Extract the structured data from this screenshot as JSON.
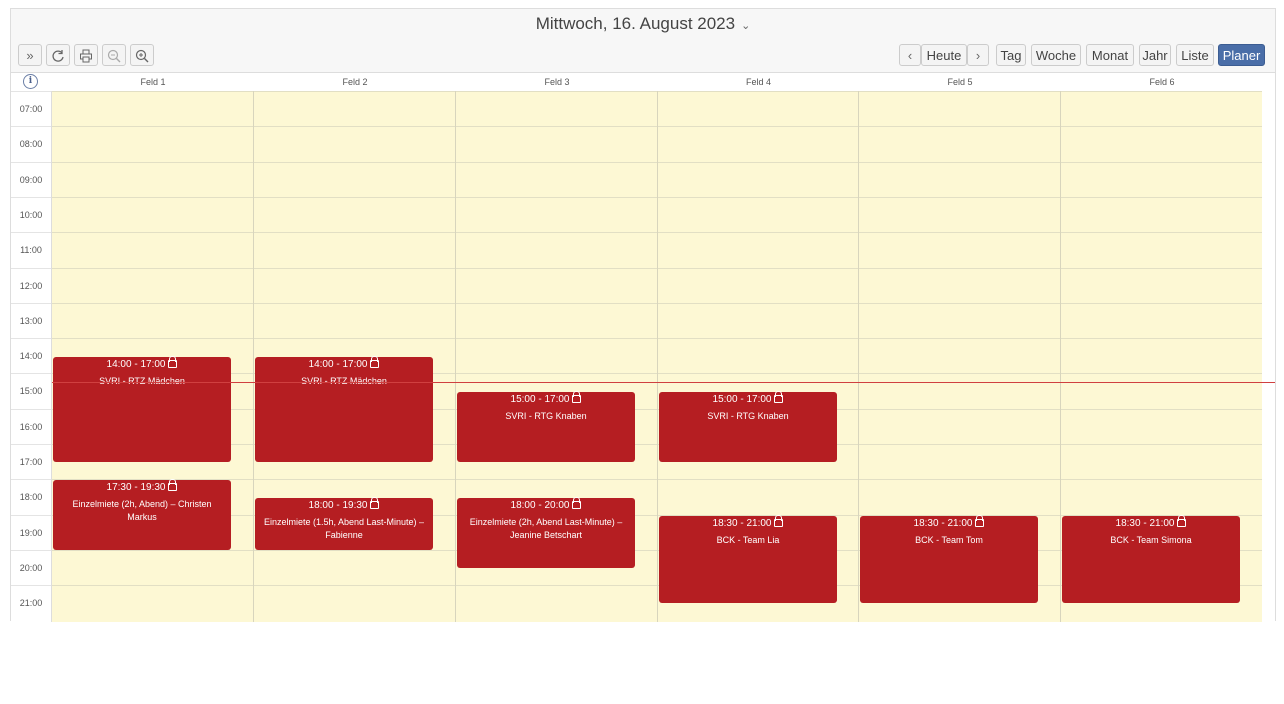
{
  "header": {
    "title": "Mittwoch, 16. August 2023"
  },
  "toolbar": {
    "nav_today": "Heute",
    "views": [
      "Tag",
      "Woche",
      "Monat",
      "Jahr",
      "Liste",
      "Planer"
    ],
    "active_view": "Planer"
  },
  "columns": [
    "Feld 1",
    "Feld 2",
    "Feld 3",
    "Feld 4",
    "Feld 5",
    "Feld 6"
  ],
  "times": [
    "07:00",
    "08:00",
    "09:00",
    "10:00",
    "11:00",
    "12:00",
    "13:00",
    "14:00",
    "15:00",
    "16:00",
    "17:00",
    "18:00",
    "19:00",
    "20:00",
    "21:00"
  ],
  "current_time": "14:45",
  "events": [
    {
      "column": 0,
      "start": "14:00",
      "end": "17:00",
      "time": "14:00 - 17:00",
      "title": "SVRI - RTZ Mädchen",
      "locked": true
    },
    {
      "column": 1,
      "start": "14:00",
      "end": "17:00",
      "time": "14:00 - 17:00",
      "title": "SVRI - RTZ Mädchen",
      "locked": true
    },
    {
      "column": 2,
      "start": "15:00",
      "end": "17:00",
      "time": "15:00 - 17:00",
      "title": "SVRI - RTG Knaben",
      "locked": true
    },
    {
      "column": 3,
      "start": "15:00",
      "end": "17:00",
      "time": "15:00 - 17:00",
      "title": "SVRI - RTG Knaben",
      "locked": true
    },
    {
      "column": 0,
      "start": "17:30",
      "end": "19:30",
      "time": "17:30 - 19:30",
      "title": "Einzelmiete (2h, Abend) – Christen Markus",
      "locked": true
    },
    {
      "column": 1,
      "start": "18:00",
      "end": "19:30",
      "time": "18:00 - 19:30",
      "title": "Einzelmiete (1.5h, Abend Last-Minute) – Fabienne",
      "locked": true
    },
    {
      "column": 2,
      "start": "18:00",
      "end": "20:00",
      "time": "18:00 - 20:00",
      "title": "Einzelmiete (2h, Abend Last-Minute) – Jeanine Betschart",
      "locked": true
    },
    {
      "column": 3,
      "start": "18:30",
      "end": "21:00",
      "time": "18:30 - 21:00",
      "title": "BCK - Team Lia",
      "locked": true
    },
    {
      "column": 4,
      "start": "18:30",
      "end": "21:00",
      "time": "18:30 - 21:00",
      "title": "BCK - Team Tom",
      "locked": true
    },
    {
      "column": 5,
      "start": "18:30",
      "end": "21:00",
      "time": "18:30 - 21:00",
      "title": "BCK - Team Simona",
      "locked": true
    }
  ],
  "colors": {
    "event": "#b51e22",
    "background": "#fdf8d4",
    "active_button": "#4a6ea8",
    "now_line": "#d04040"
  },
  "icons": [
    "expand-icon",
    "refresh-icon",
    "print-icon",
    "zoom-out-icon",
    "zoom-in-icon",
    "info-icon",
    "chevron-left-icon",
    "chevron-right-icon",
    "lock-icon"
  ]
}
